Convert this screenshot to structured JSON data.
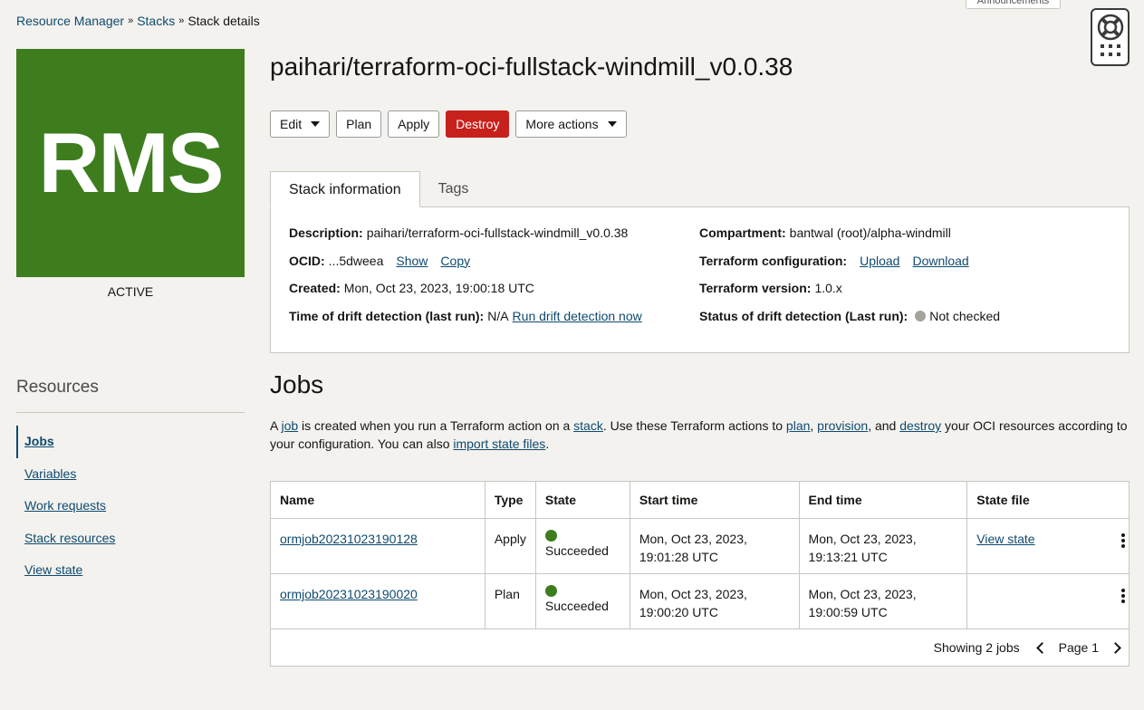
{
  "breadcrumb": {
    "items": [
      "Resource Manager",
      "Stacks",
      "Stack details"
    ]
  },
  "announcements_label": "Announcements",
  "logo_text": "RMS",
  "lifecycle_state": "ACTIVE",
  "stack_title": "paihari/terraform-oci-fullstack-windmill_v0.0.38",
  "actions": {
    "edit": "Edit",
    "plan": "Plan",
    "apply": "Apply",
    "destroy": "Destroy",
    "more": "More actions"
  },
  "tabs": [
    "Stack information",
    "Tags"
  ],
  "stack_info": {
    "description_label": "Description:",
    "description": "paihari/terraform-oci-fullstack-windmill_v0.0.38",
    "ocid_label": "OCID:",
    "ocid": "...5dweea",
    "show": "Show",
    "copy": "Copy",
    "created_label": "Created:",
    "created": "Mon, Oct 23, 2023, 19:00:18 UTC",
    "drift_time_label": "Time of drift detection (last run):",
    "drift_time": "N/A",
    "run_drift": "Run drift detection now",
    "compartment_label": "Compartment:",
    "compartment": "bantwal (root)/alpha-windmill",
    "tf_config_label": "Terraform configuration:",
    "upload": "Upload",
    "download": "Download",
    "tf_version_label": "Terraform version:",
    "tf_version": "1.0.x",
    "drift_status_label": "Status of drift detection (Last run):",
    "drift_status": "Not checked"
  },
  "resources": {
    "title": "Resources",
    "items": [
      "Jobs",
      "Variables",
      "Work requests",
      "Stack resources",
      "View state"
    ]
  },
  "jobs": {
    "title": "Jobs",
    "desc": {
      "t1": "A ",
      "job": "job",
      "t2": " is created when you run a Terraform action on a ",
      "stack": "stack",
      "t3": ". Use these Terraform actions to ",
      "plan": "plan",
      "t4": ", ",
      "provision": "provision",
      "t5": ", and ",
      "destroy": "destroy",
      "t6": " your OCI resources according to your configuration. You can also ",
      "import": "import state files",
      "t7": "."
    },
    "columns": [
      "Name",
      "Type",
      "State",
      "Start time",
      "End time",
      "State file"
    ],
    "rows": [
      {
        "name": "ormjob20231023190128",
        "type": "Apply",
        "state": "Succeeded",
        "start_date": "Mon, Oct 23, 2023,",
        "start_time": "19:01:28 UTC",
        "end_date": "Mon, Oct 23, 2023,",
        "end_time": "19:13:21 UTC",
        "state_file": "View state"
      },
      {
        "name": "ormjob20231023190020",
        "type": "Plan",
        "state": "Succeeded",
        "start_date": "Mon, Oct 23, 2023,",
        "start_time": "19:00:20 UTC",
        "end_date": "Mon, Oct 23, 2023,",
        "end_time": "19:00:59 UTC",
        "state_file": ""
      }
    ],
    "showing": "Showing 2 jobs",
    "page": "Page 1"
  },
  "colors": {
    "brand_green": "#3d7d1e",
    "destroy_red": "#c7211b",
    "link": "#0e4a6e"
  }
}
